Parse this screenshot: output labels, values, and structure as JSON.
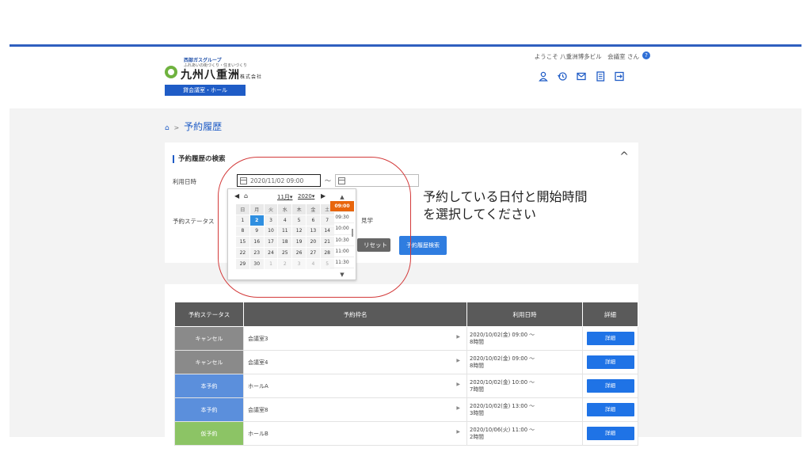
{
  "header": {
    "logo_group": "西部ガスグループ",
    "logo_tagline": "ふれあいの街づくり・住まいづくり",
    "logo_company": "九州八重洲",
    "logo_company_suffix": "株式会社",
    "logo_badge": "貸会議室・ホール",
    "welcome": "ようこそ 八重洲博多ビル　会議室 さん",
    "help_icon": "?",
    "icons": [
      "user-icon",
      "history-icon",
      "mail-icon",
      "document-icon",
      "logout-icon"
    ],
    "accent_color": "#1f5cc6"
  },
  "breadcrumb": {
    "home_icon": "⌂",
    "separator": ">",
    "current": "予約履歴"
  },
  "search": {
    "title": "予約履歴の検索",
    "collapse_icon": "^",
    "date_label": "利用日時",
    "date_from": "2020/11/02 09:00",
    "date_to": "",
    "tilde": "～",
    "status_label": "予約ステータス",
    "status_extra": "見学",
    "reset_label": "リセット",
    "search_label": "予約履歴検索"
  },
  "picker": {
    "prev": "◀",
    "home": "⌂",
    "month": "11月",
    "year": "2020",
    "next": "▶",
    "dow": [
      "日",
      "月",
      "火",
      "水",
      "木",
      "金",
      "土"
    ],
    "weeks": [
      [
        "1",
        "2",
        "3",
        "4",
        "5",
        "6",
        "7"
      ],
      [
        "8",
        "9",
        "10",
        "11",
        "12",
        "13",
        "14"
      ],
      [
        "15",
        "16",
        "17",
        "18",
        "19",
        "20",
        "21"
      ],
      [
        "22",
        "23",
        "24",
        "25",
        "26",
        "27",
        "28"
      ],
      [
        "29",
        "30",
        "1",
        "2",
        "3",
        "4",
        "5"
      ]
    ],
    "selected_day": "2",
    "times": [
      "09:00",
      "09:30",
      "10:00",
      "10:30",
      "11:00",
      "11:30"
    ],
    "selected_time": "09:00",
    "up": "▲",
    "down": "▼"
  },
  "annotation": {
    "line1": "予約している日付と開始時間",
    "line2": "を選択してください"
  },
  "table": {
    "headers": [
      "予約ステータス",
      "予約枠名",
      "利用日時",
      "詳細"
    ],
    "rows": [
      {
        "status": "キャンセル",
        "status_color": "#8a8a8a",
        "name": "会議室3",
        "date": "2020/10/02(金) 09:00 ～",
        "duration": "8時間",
        "detail": "詳細"
      },
      {
        "status": "キャンセル",
        "status_color": "#8a8a8a",
        "name": "会議室4",
        "date": "2020/10/02(金) 09:00 ～",
        "duration": "8時間",
        "detail": "詳細"
      },
      {
        "status": "本予約",
        "status_color": "#5b8fdc",
        "name": "ホールA",
        "date": "2020/10/02(金) 10:00 ～",
        "duration": "7時間",
        "detail": "詳細"
      },
      {
        "status": "本予約",
        "status_color": "#5b8fdc",
        "name": "会議室8",
        "date": "2020/10/02(金) 13:00 ～",
        "duration": "3時間",
        "detail": "詳細"
      },
      {
        "status": "仮予約",
        "status_color": "#8cc465",
        "name": "ホールB",
        "date": "2020/10/06(火) 11:00 ～",
        "duration": "2時間",
        "detail": "詳細"
      }
    ]
  }
}
